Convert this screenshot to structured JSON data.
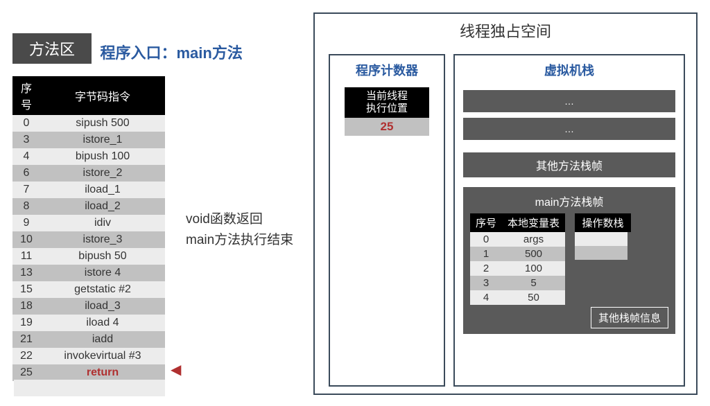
{
  "methodArea": {
    "tag": "方法区",
    "entryLabel": "程序入口：main方法",
    "tableHeaders": {
      "index": "序号",
      "instruction": "字节码指令"
    },
    "rows": [
      {
        "idx": "0",
        "instr": "sipush 500"
      },
      {
        "idx": "3",
        "instr": "istore_1"
      },
      {
        "idx": "4",
        "instr": "bipush 100"
      },
      {
        "idx": "6",
        "instr": "istore_2"
      },
      {
        "idx": "7",
        "instr": "iload_1"
      },
      {
        "idx": "8",
        "instr": "iload_2"
      },
      {
        "idx": "9",
        "instr": "idiv"
      },
      {
        "idx": "10",
        "instr": "istore_3"
      },
      {
        "idx": "11",
        "instr": "bipush 50"
      },
      {
        "idx": "13",
        "instr": "istore 4"
      },
      {
        "idx": "15",
        "instr": "getstatic #2"
      },
      {
        "idx": "18",
        "instr": "iload_3"
      },
      {
        "idx": "19",
        "instr": "iload 4"
      },
      {
        "idx": "21",
        "instr": "iadd"
      },
      {
        "idx": "22",
        "instr": "invokevirtual #3"
      },
      {
        "idx": "25",
        "instr": "return",
        "highlight": true
      }
    ],
    "annotation": {
      "line1": "void函数返回",
      "line2": "main方法执行结束"
    }
  },
  "threadSpace": {
    "title": "线程独占空间",
    "pc": {
      "label": "程序计数器",
      "boxHeader1": "当前线程",
      "boxHeader2": "执行位置",
      "value": "25"
    },
    "vmStack": {
      "label": "虚拟机栈",
      "slotPlaceholder": "…",
      "otherFramesLabel": "其他方法栈帧",
      "mainFrame": {
        "title": "main方法栈帧",
        "localsHeaders": {
          "index": "序号",
          "var": "本地变量表"
        },
        "locals": [
          {
            "idx": "0",
            "val": "args"
          },
          {
            "idx": "1",
            "val": "500"
          },
          {
            "idx": "2",
            "val": "100"
          },
          {
            "idx": "3",
            "val": "5"
          },
          {
            "idx": "4",
            "val": "50"
          }
        ],
        "opStackHeader": "操作数栈",
        "otherInfoLabel": "其他栈帧信息"
      }
    }
  }
}
